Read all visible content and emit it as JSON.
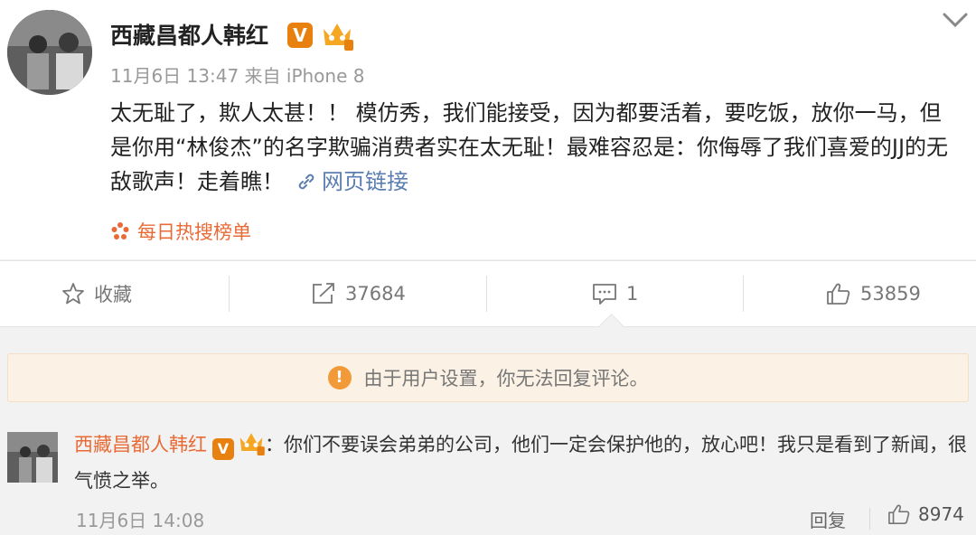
{
  "post": {
    "author": "西藏昌都人韩红",
    "verified_badge": "V",
    "time": "11月6日 13:47",
    "source_prefix": "来自",
    "source": "iPhone 8",
    "text": "太无耻了，欺人太甚！！ 模仿秀，我们能接受，因为都要活着，要吃饭，放你一马，但是你用“林俊杰”的名字欺骗消费者实在太无耻！最难容忍是：你侮辱了我们喜爱的JJ的无敌歌声！走着瞧！",
    "link_label": "网页链接",
    "hot_label": "每日热搜榜单",
    "menu_icon": "chevron-down-icon"
  },
  "actions": {
    "favorite_label": "收藏",
    "repost_count": "37684",
    "comment_count": "1",
    "like_count": "53859"
  },
  "notice": {
    "icon": "!",
    "text": "由于用户设置，你无法回复评论。"
  },
  "comment": {
    "author": "西藏昌都人韩红",
    "verified_badge": "V",
    "separator": "：",
    "text": "你们不要误会弟弟的公司，他们一定会保护他的，放心吧！我只是看到了新闻，很气愤之举。",
    "time": "11月6日 14:08",
    "reply_label": "回复",
    "like_count": "8974"
  },
  "colors": {
    "accent_orange": "#e86b36",
    "link_blue": "#5b7db1",
    "badge_orange": "#e8800f",
    "notice_bg": "#fbf1e4"
  }
}
